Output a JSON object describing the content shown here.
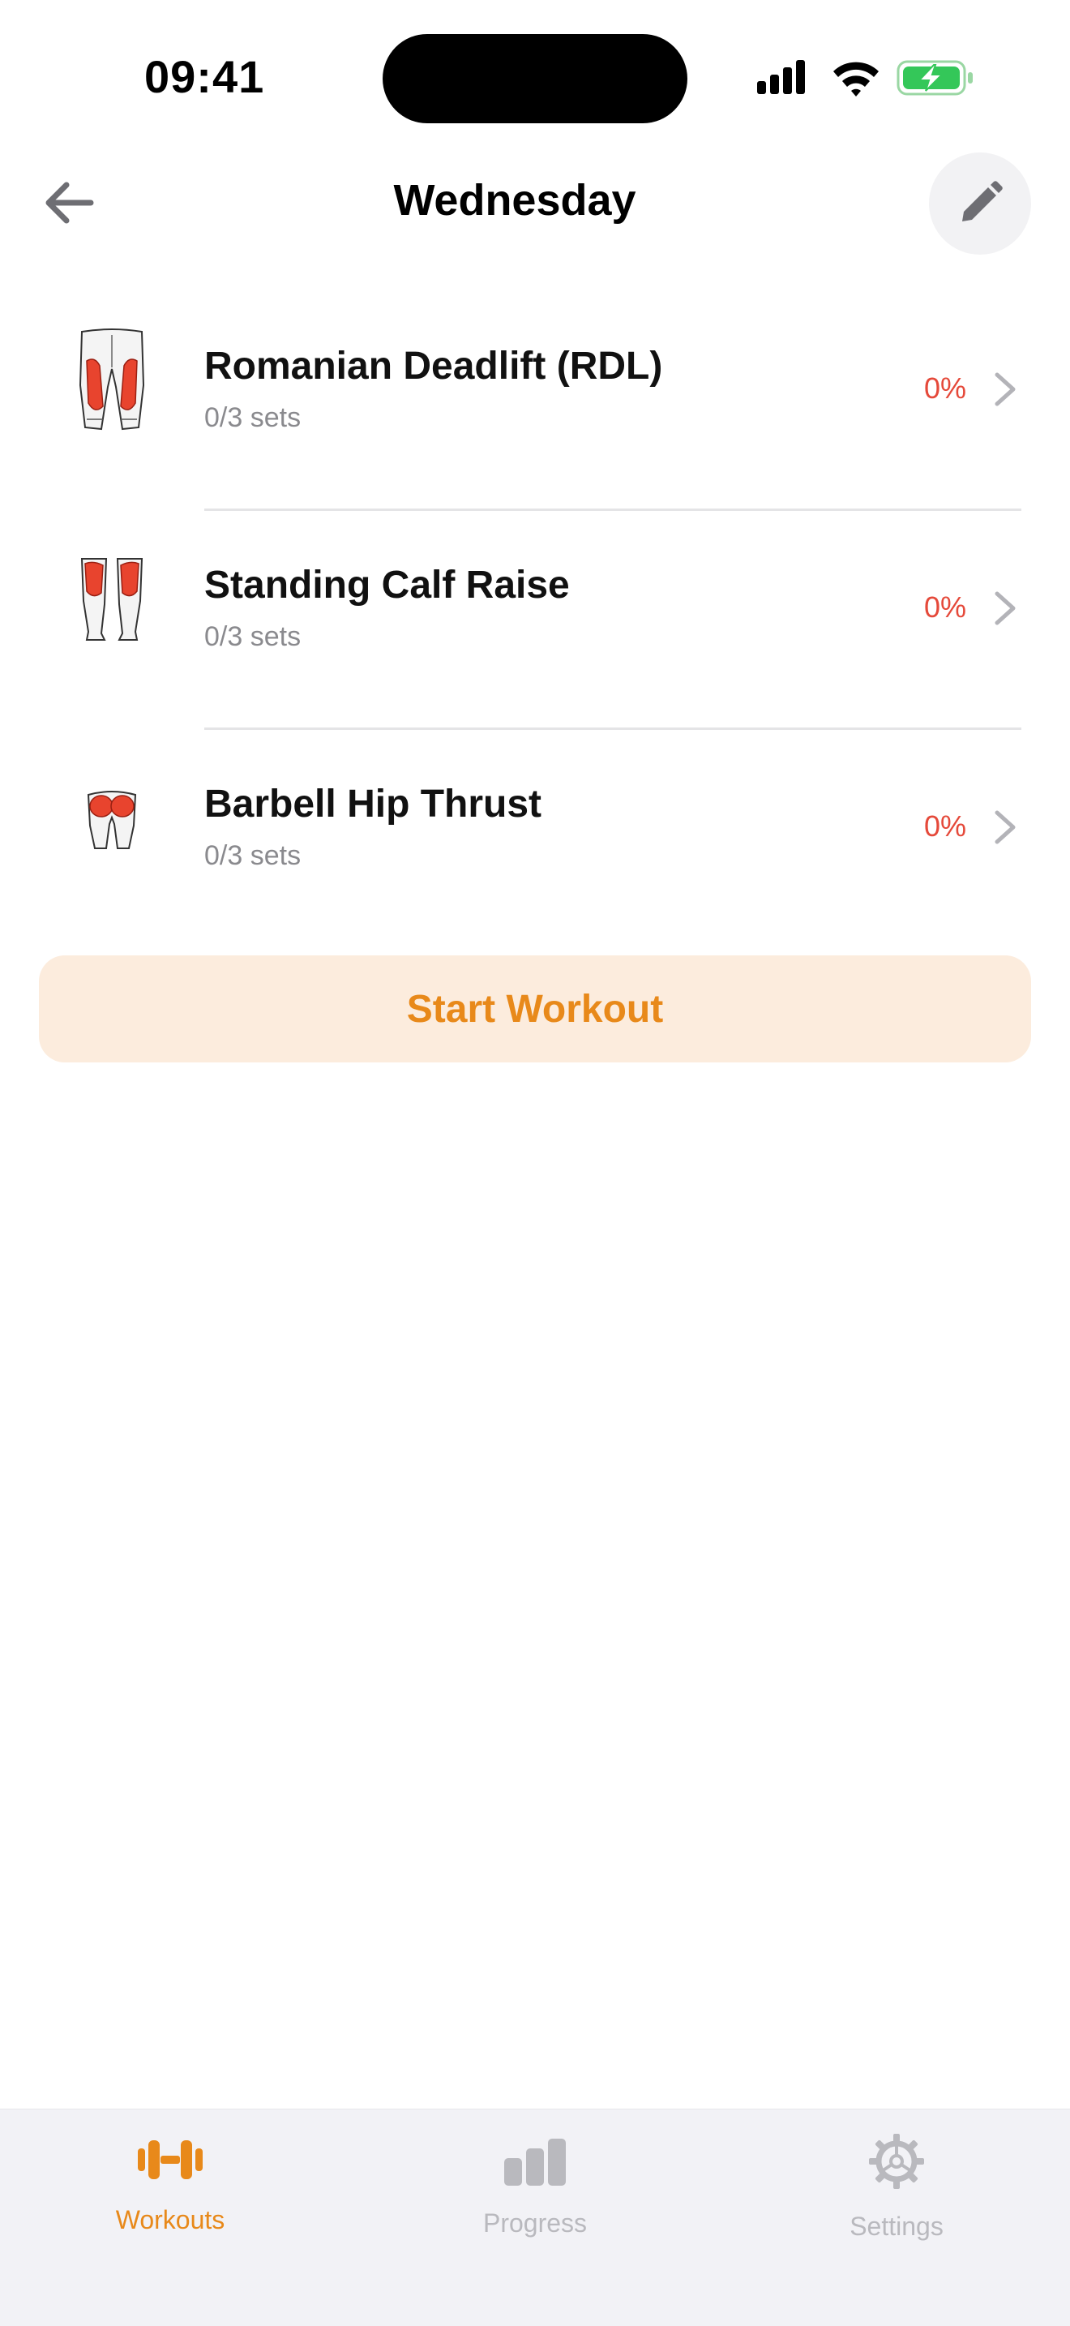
{
  "status_bar": {
    "time": "09:41"
  },
  "nav": {
    "title": "Wednesday",
    "back_icon": "arrow-left-icon",
    "edit_icon": "pencil-icon"
  },
  "exercises": [
    {
      "name": "Romanian Deadlift (RDL)",
      "sets": "0/3 sets",
      "progress": "0%",
      "muscle_icon": "hamstrings-icon"
    },
    {
      "name": "Standing Calf Raise",
      "sets": "0/3 sets",
      "progress": "0%",
      "muscle_icon": "calves-icon"
    },
    {
      "name": "Barbell Hip Thrust",
      "sets": "0/3 sets",
      "progress": "0%",
      "muscle_icon": "glutes-icon"
    }
  ],
  "start_button": {
    "label": "Start Workout"
  },
  "tabs": [
    {
      "label": "Workouts",
      "icon": "dumbbell-icon",
      "active": true
    },
    {
      "label": "Progress",
      "icon": "bar-chart-icon",
      "active": false
    },
    {
      "label": "Settings",
      "icon": "gear-icon",
      "active": false
    }
  ],
  "colors": {
    "accent": "#E8891A",
    "accent_bg": "#FCECDD",
    "progress_text": "#E5493A",
    "inactive_tab": "#B9B9BE",
    "muscle_highlight": "#E8442E"
  }
}
